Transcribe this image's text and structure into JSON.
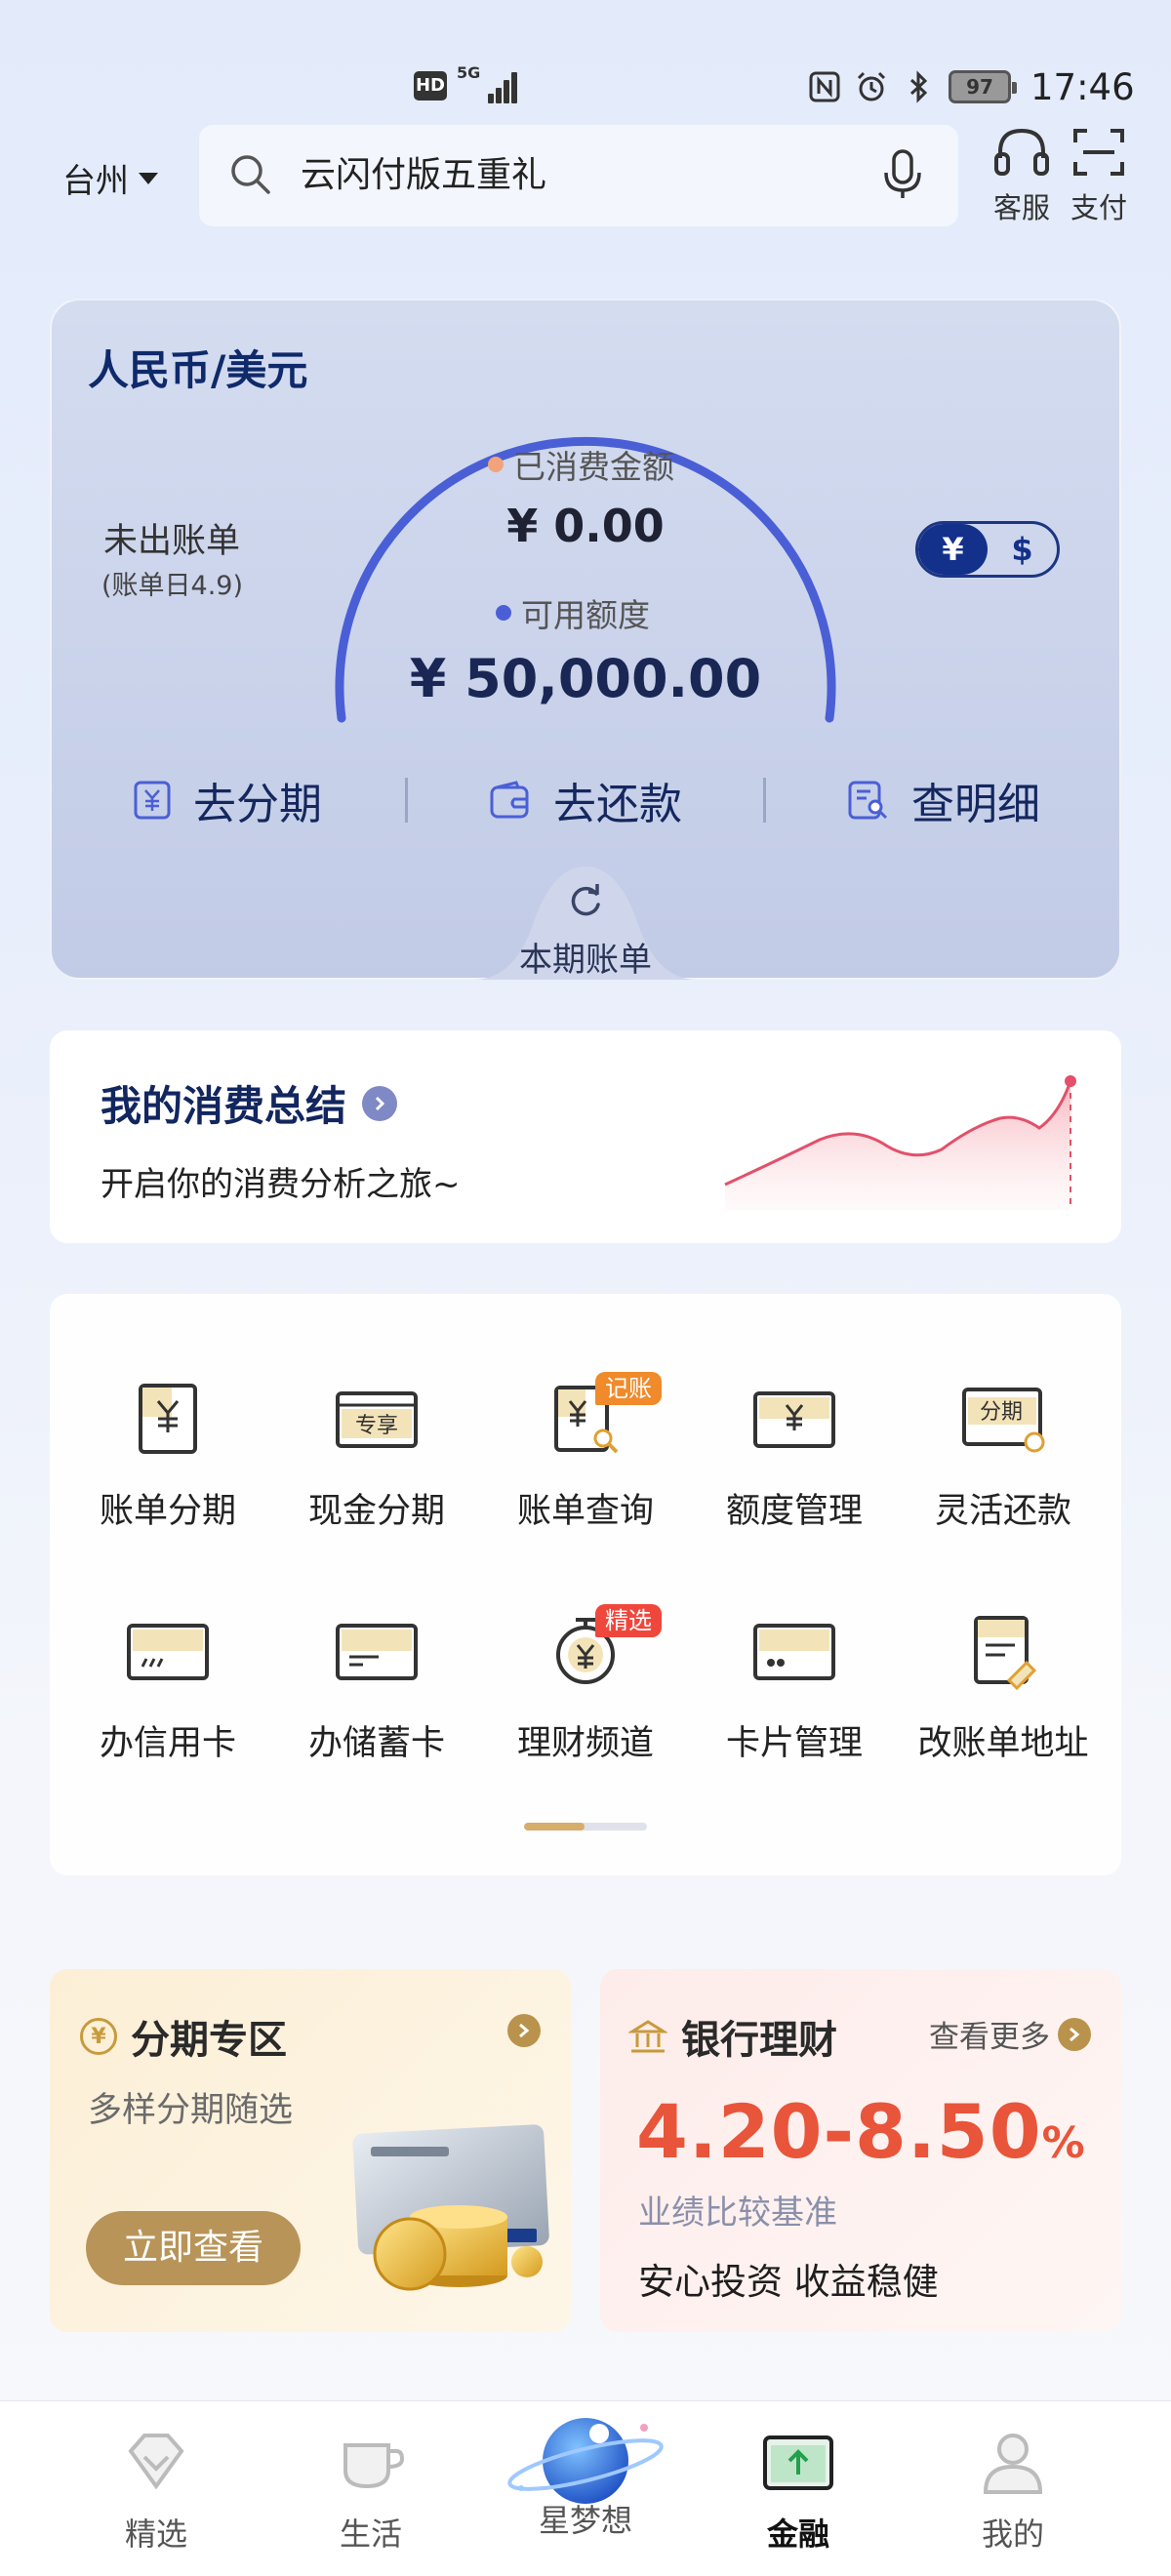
{
  "status_bar": {
    "hd": "HD",
    "network": "5G",
    "battery": "97",
    "time": "17:46"
  },
  "header": {
    "city": "台州",
    "search_placeholder": "云闪付版五重礼",
    "service_label": "客服",
    "pay_label": "支付"
  },
  "credit_card": {
    "title": "人民币/美元",
    "unbilled_label": "未出账单",
    "bill_day": "(账单日4.9)",
    "spent_label": "已消费金额",
    "spent_value": "¥ 0.00",
    "available_label": "可用额度",
    "available_value": "¥ 50,000.00",
    "currency_rmb": "¥",
    "currency_usd": "$",
    "actions": [
      "去分期",
      "去还款",
      "查明细"
    ],
    "bill_tab": "本期账单",
    "colors": {
      "arc": "#4a5fd6",
      "spent_dot": "#f2a37c",
      "available_dot": "#4a5fd6"
    }
  },
  "summary": {
    "title": "我的消费总结",
    "subtitle": "开启你的消费分析之旅~"
  },
  "services": [
    {
      "label": "账单分期",
      "icon": "bill-installment-icon",
      "badge": ""
    },
    {
      "label": "现金分期",
      "icon": "cash-installment-icon",
      "badge": "",
      "icon_text": "专享"
    },
    {
      "label": "账单查询",
      "icon": "bill-query-icon",
      "badge": "记账"
    },
    {
      "label": "额度管理",
      "icon": "limit-management-icon",
      "badge": ""
    },
    {
      "label": "灵活还款",
      "icon": "flexible-repay-icon",
      "badge": "",
      "icon_text": "分期"
    },
    {
      "label": "办信用卡",
      "icon": "apply-credit-card-icon",
      "badge": ""
    },
    {
      "label": "办储蓄卡",
      "icon": "apply-debit-card-icon",
      "badge": ""
    },
    {
      "label": "理财频道",
      "icon": "wealth-channel-icon",
      "badge": "精选"
    },
    {
      "label": "卡片管理",
      "icon": "card-management-icon",
      "badge": ""
    },
    {
      "label": "改账单地址",
      "icon": "change-address-icon",
      "badge": ""
    }
  ],
  "pager": {
    "current_page": 1,
    "total_pages": 2
  },
  "promo_installment": {
    "icon_text": "¥",
    "title": "分期专区",
    "subtitle": "多样分期随选",
    "button": "立即查看"
  },
  "promo_wealth": {
    "title": "银行理财",
    "more": "查看更多",
    "rate": "4.20-8.50",
    "rate_unit": "%",
    "benchmark": "业绩比较基准",
    "slogan": "安心投资 收益稳健"
  },
  "bottom_nav": [
    {
      "label": "精选",
      "icon": "featured-icon",
      "active": false
    },
    {
      "label": "生活",
      "icon": "life-icon",
      "active": false
    },
    {
      "label": "星梦想",
      "icon": "star-dream-icon",
      "active": false
    },
    {
      "label": "金融",
      "icon": "finance-icon",
      "active": true
    },
    {
      "label": "我的",
      "icon": "profile-icon",
      "active": false
    }
  ]
}
